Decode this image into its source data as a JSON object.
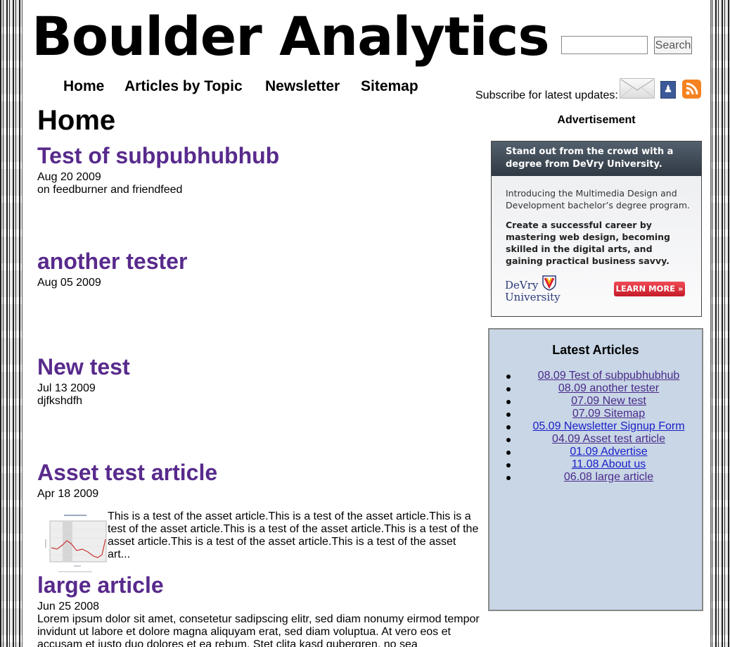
{
  "site": {
    "title": "Boulder Analytics"
  },
  "search": {
    "placeholder": "",
    "button_label": "Search"
  },
  "nav": {
    "items": [
      "Home",
      "Articles by Topic",
      "Newsletter",
      "Sitemap"
    ]
  },
  "subscribe": {
    "label": "Subscribe for latest updates:"
  },
  "page": {
    "title": "Home"
  },
  "articles": [
    {
      "title": "Test of subpubhubhub",
      "date": "Aug 20 2009",
      "excerpt": "on feedburner and friendfeed"
    },
    {
      "title": "another tester",
      "date": "Aug 05 2009",
      "excerpt": ""
    },
    {
      "title": "New test",
      "date": "Jul 13 2009",
      "excerpt": "djfkshdfh"
    },
    {
      "title": "Asset test article",
      "date": "Apr 18 2009",
      "excerpt": "This is a test of the asset article.This is a test of the asset article.This is a test of the asset article.This is a test of the asset article.This is a test of the asset article.This is a test of the asset article.This is a test of the asset art..."
    },
    {
      "title": "large article",
      "date": "Jun 25 2008",
      "excerpt": "Lorem ipsum dolor sit amet, consetetur sadipscing elitr, sed diam nonumy eirmod tempor invidunt ut labore et dolore magna aliquyam erat, sed diam voluptua. At vero eos et accusam et justo duo dolores et ea rebum. Stet clita kasd gubergren, no sea"
    }
  ],
  "ad": {
    "label": "Advertisement",
    "headline": "Stand out from the crowd with a degree from DeVry University.",
    "intro": "Introducing the Multimedia Design and Development bachelor’s degree program.",
    "description": "Create a successful career by mastering web design, becoming skilled in the digital arts, and gaining practical business savvy.",
    "logo_line1": "DeVry",
    "logo_line2": "University",
    "cta": "LEARN MORE »"
  },
  "latest": {
    "title": "Latest Articles",
    "items": [
      {
        "label": "08.09 Test of subpubhubhub"
      },
      {
        "label": "08.09 another tester"
      },
      {
        "label": "07.09 New test"
      },
      {
        "label": "07.09 Sitemap"
      },
      {
        "label": "05.09 Newsletter Signup Form"
      },
      {
        "label": "04.09 Asset test article"
      },
      {
        "label": "01.09 Advertise"
      },
      {
        "label": "11.08 About us"
      },
      {
        "label": "06.08 large article"
      }
    ]
  },
  "colors": {
    "link_visited": "#582a8c",
    "link": "#1a20c8",
    "sidebar_bg": "#c8d6e6"
  },
  "icons": [
    "email-icon",
    "facebook-icon",
    "rss-icon"
  ]
}
